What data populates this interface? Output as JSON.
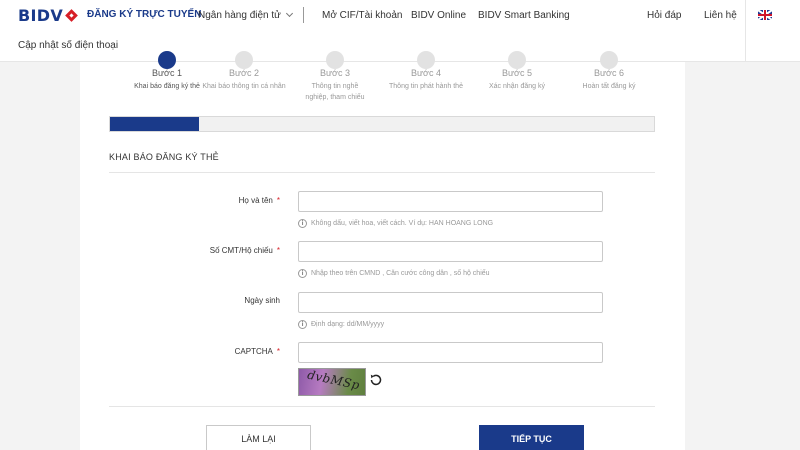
{
  "header": {
    "logo_text": "BIDV",
    "brand_label": "ĐĂNG KÝ TRỰC TUYẾN",
    "nav": {
      "ebanking": "Ngân hàng điện tử",
      "cif": "Mở CIF/Tài khoản",
      "online": "BIDV Online",
      "smart": "BIDV Smart Banking",
      "faq": "Hỏi đáp",
      "contact": "Liên hệ",
      "update_phone": "Cập nhật số điện thoại"
    },
    "language_flag": "uk-flag-icon"
  },
  "steps": [
    {
      "title": "Bước 1",
      "desc": "Khai báo đăng ký thẻ"
    },
    {
      "title": "Bước 2",
      "desc": "Khai báo thông tin cá nhân"
    },
    {
      "title": "Bước 3",
      "desc": "Thông tin nghề nghiệp, tham chiếu"
    },
    {
      "title": "Bước 4",
      "desc": "Thông tin phát hành thẻ"
    },
    {
      "title": "Bước 5",
      "desc": "Xác nhận đăng ký"
    },
    {
      "title": "Bước 6",
      "desc": "Hoàn tất đăng ký"
    }
  ],
  "active_step": 1,
  "progress": {
    "fraction": 0.163
  },
  "form": {
    "section_title": "KHAI BÁO ĐĂNG KÝ THẺ",
    "required_mark": "*",
    "fields": {
      "fullname": {
        "label": "Họ và tên",
        "value": "",
        "hint": "Không dấu, viết hoa, viết cách. Ví dụ: HAN HOANG LONG"
      },
      "idcard": {
        "label": "Số CMT/Hộ chiếu",
        "value": "",
        "hint": "Nhập theo trên CMND , Căn cước công dân , số hộ chiếu"
      },
      "birthday": {
        "label": "Ngày sinh",
        "value": "",
        "hint": "Định dạng: dd/MM/yyyy"
      },
      "captcha": {
        "label": "CAPTCHA",
        "value": "",
        "image_text": "dvbMSp"
      }
    },
    "buttons": {
      "reset": "LÀM LẠI",
      "next": "TIẾP TỤC"
    }
  },
  "colors": {
    "brand_blue": "#1a3a8a",
    "brand_red": "#d71f27"
  }
}
